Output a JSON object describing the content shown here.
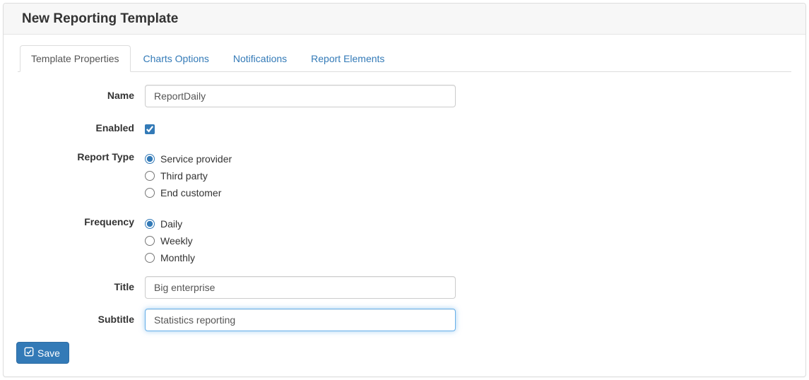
{
  "header": {
    "title": "New Reporting Template"
  },
  "tabs": {
    "template_properties": "Template Properties",
    "charts_options": "Charts Options",
    "notifications": "Notifications",
    "report_elements": "Report Elements"
  },
  "form": {
    "labels": {
      "name": "Name",
      "enabled": "Enabled",
      "report_type": "Report Type",
      "frequency": "Frequency",
      "title": "Title",
      "subtitle": "Subtitle"
    },
    "values": {
      "name": "ReportDaily",
      "enabled": true,
      "title": "Big enterprise",
      "subtitle": "Statistics reporting"
    },
    "report_type_options": {
      "service_provider": "Service provider",
      "third_party": "Third party",
      "end_customer": "End customer"
    },
    "frequency_options": {
      "daily": "Daily",
      "weekly": "Weekly",
      "monthly": "Monthly"
    }
  },
  "buttons": {
    "save": "Save"
  }
}
